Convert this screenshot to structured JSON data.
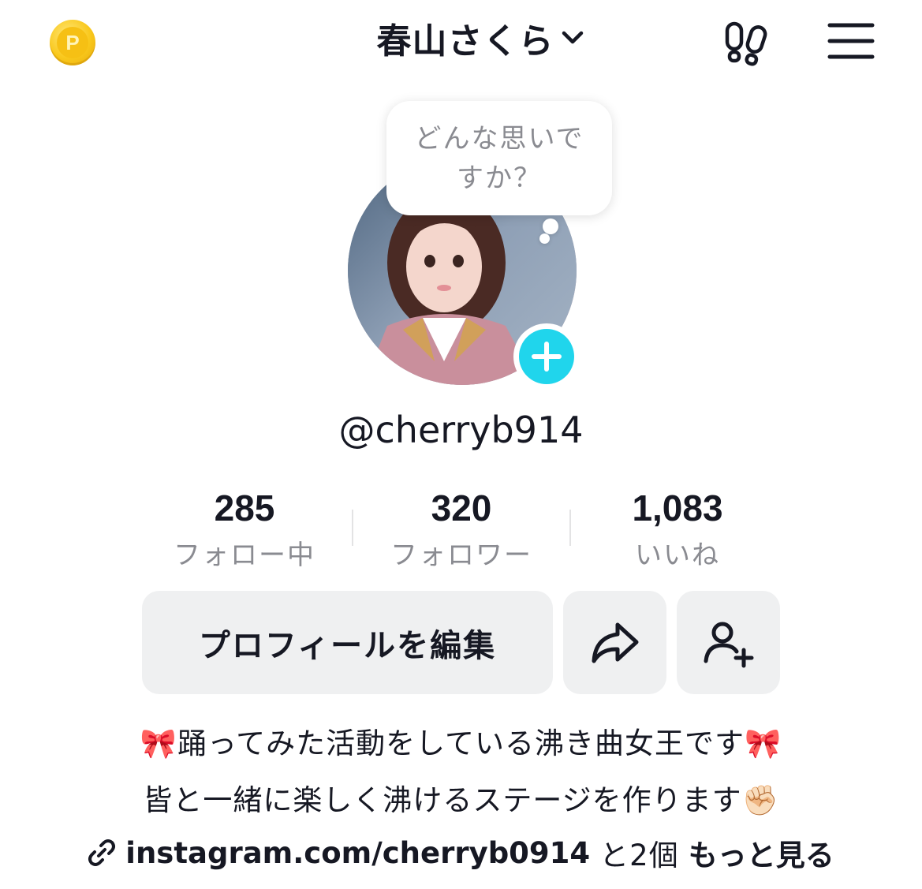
{
  "header": {
    "account_name": "春山さくら",
    "coin_icon": "coin-icon",
    "coin_letter": "P",
    "footprint_icon": "footprint-icon",
    "menu_icon": "hamburger-menu-icon"
  },
  "avatar": {
    "bubble_text": "どんな思いですか？",
    "add_icon": "plus-icon",
    "accent_color": "#20d5ec"
  },
  "profile": {
    "username": "@cherryb914"
  },
  "stats": [
    {
      "value": "285",
      "label": "フォロー中"
    },
    {
      "value": "320",
      "label": "フォロワー"
    },
    {
      "value": "1,083",
      "label": "いいね"
    }
  ],
  "actions": {
    "edit_label": "プロフィールを編集",
    "share_icon": "share-arrow-icon",
    "add_friend_icon": "add-friend-icon"
  },
  "bio": {
    "line1": "🎀踊ってみた活動をしている沸き曲女王です🎀",
    "line2": "皆と一緒に楽しく沸けるステージを作ります✊🏻",
    "link_icon": "link-icon",
    "link_url": "instagram.com/cherryb0914",
    "link_extra": "と2個",
    "see_more": "もっと見る"
  }
}
